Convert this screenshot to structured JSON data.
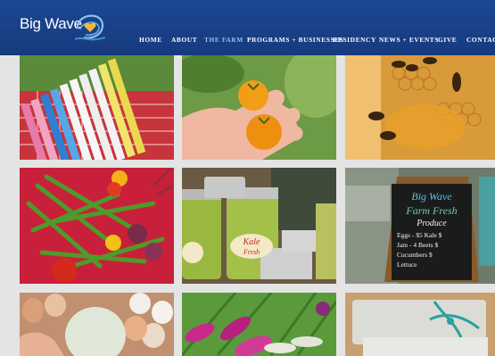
{
  "site": {
    "logo_text": "Big Wave",
    "brand_color": "#1d4794",
    "accent_color": "#8fc1ea",
    "logo_icon": "wave-heart-icon"
  },
  "nav": {
    "items": [
      {
        "label": "Home"
      },
      {
        "label": "About"
      },
      {
        "label": "The Farm",
        "active": true
      },
      {
        "label": "Programs + Businesses"
      },
      {
        "label": "Residency"
      },
      {
        "label": "News + Events"
      },
      {
        "label": "Give"
      },
      {
        "label": "Contact"
      }
    ]
  },
  "tiles": {
    "chalkboard_lines": [
      "Big Wave",
      "Farm Fresh",
      "Produce",
      "Eggs - $5  Kale $",
      "Jam - 4  Beets $",
      "Cucumbers $",
      "Lettuce"
    ],
    "jar_label_kale": "Kale",
    "jar_label_kale_2": "Fresh"
  }
}
